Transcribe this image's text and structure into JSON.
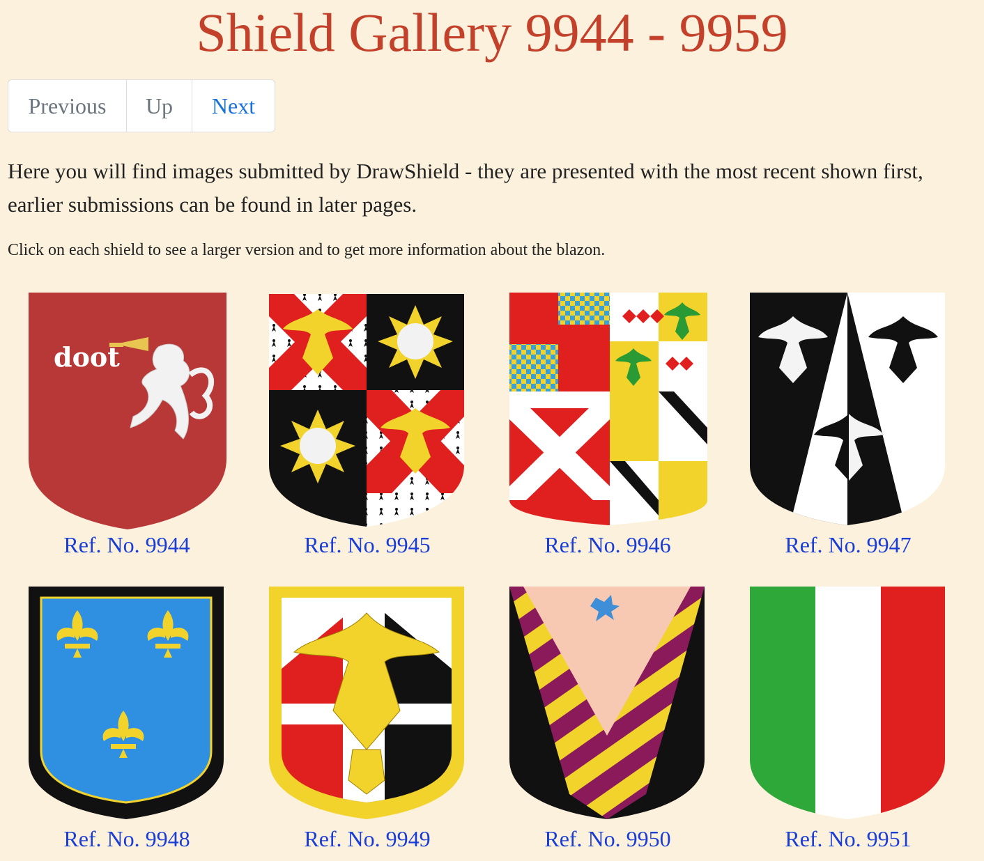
{
  "page": {
    "title": "Shield Gallery 9944 - 9959",
    "intro": "Here you will find images submitted by DrawShield - they are presented with the most recent shown first, earlier submissions can be found in later pages.",
    "hint": "Click on each shield to see a larger version and to get more information about the blazon."
  },
  "nav": {
    "previous": "Previous",
    "up": "Up",
    "next": "Next"
  },
  "shields": [
    {
      "ref": "Ref. No. 9944",
      "motto": "doot"
    },
    {
      "ref": "Ref. No. 9945"
    },
    {
      "ref": "Ref. No. 9946"
    },
    {
      "ref": "Ref. No. 9947"
    },
    {
      "ref": "Ref. No. 9948"
    },
    {
      "ref": "Ref. No. 9949"
    },
    {
      "ref": "Ref. No. 9950"
    },
    {
      "ref": "Ref. No. 9951"
    }
  ],
  "colors": {
    "background": "#fbf1dc",
    "title": "#c3402a",
    "link": "#1a3dd6",
    "gules": "#e01f1f",
    "or": "#f2d32b",
    "sable": "#111111",
    "argent": "#ffffff",
    "azure": "#2f8fe0",
    "vert": "#2fa83a",
    "purpure": "#8b1a5a"
  }
}
